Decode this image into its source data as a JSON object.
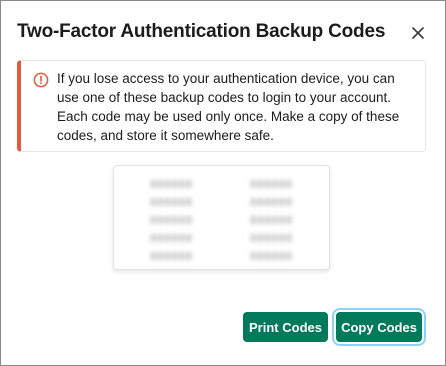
{
  "dialog": {
    "title": "Two-Factor Authentication Backup Codes",
    "close_icon": "close-icon"
  },
  "alert": {
    "icon": "alert-circle-icon",
    "accent_color": "#e05a3c",
    "message": "If you lose access to your authentication device, you can use one of these backup codes to login to your account. Each code may be used only once. Make a copy of these codes, and store it somewhere safe."
  },
  "codes": {
    "column_1": [
      "",
      "",
      "",
      "",
      ""
    ],
    "column_2": [
      "",
      "",
      "",
      "",
      ""
    ]
  },
  "buttons": {
    "print_label": "Print Codes",
    "copy_label": "Copy Codes",
    "color": "#007a5a"
  }
}
